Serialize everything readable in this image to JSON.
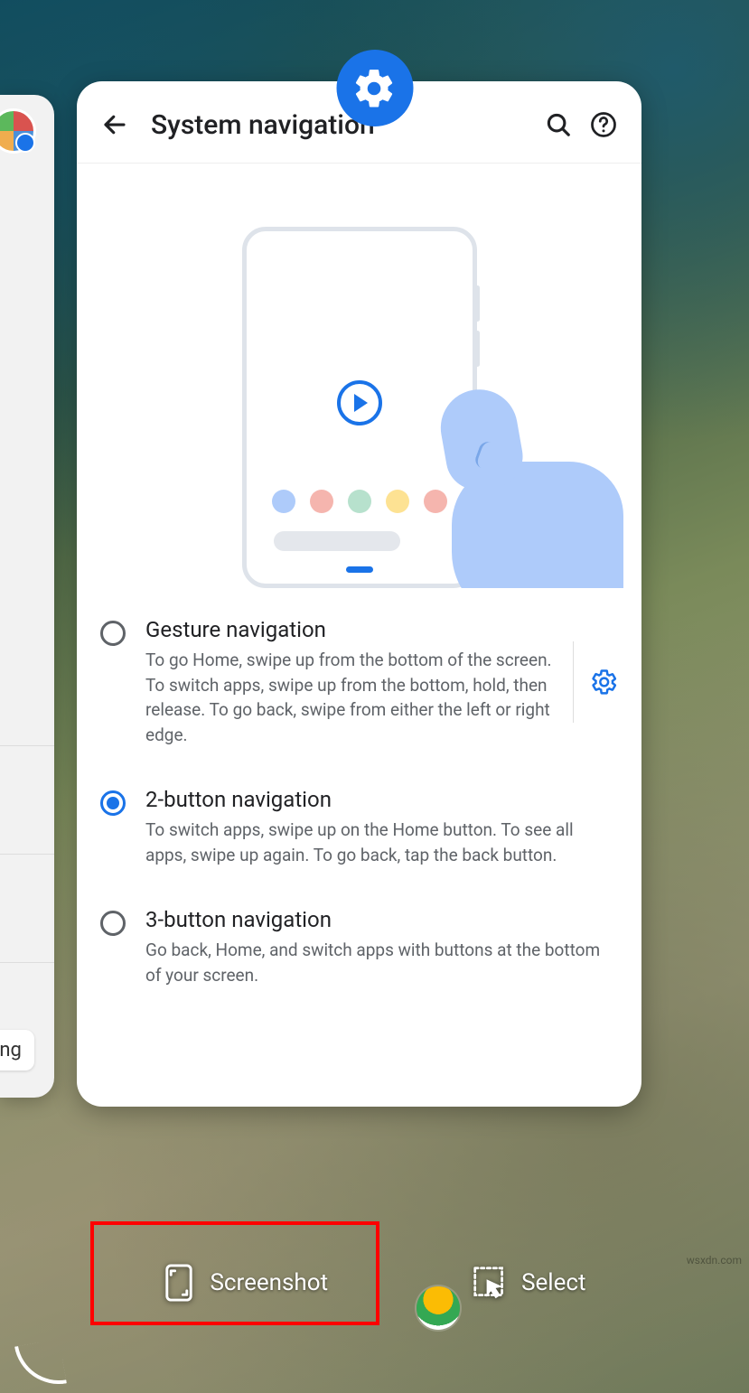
{
  "header": {
    "title": "System navigation"
  },
  "options": [
    {
      "title": "Gesture navigation",
      "desc": "To go Home, swipe up from the bottom of the screen. To switch apps, swipe up from the bottom, hold, then release. To go back, swipe from either the left or right edge.",
      "selected": false,
      "has_config": true
    },
    {
      "title": "2-button navigation",
      "desc": "To switch apps, swipe up on the Home button. To see all apps, swipe up again. To go back, tap the back button.",
      "selected": true,
      "has_config": false
    },
    {
      "title": "3-button navigation",
      "desc": "Go back, Home, and switch apps with buttons at the bottom of your screen.",
      "selected": false,
      "has_config": false
    }
  ],
  "actions": {
    "screenshot": "Screenshot",
    "select": "Select"
  },
  "left_card": {
    "chip_fragment": "ing"
  },
  "watermark": "wsxdn.com"
}
